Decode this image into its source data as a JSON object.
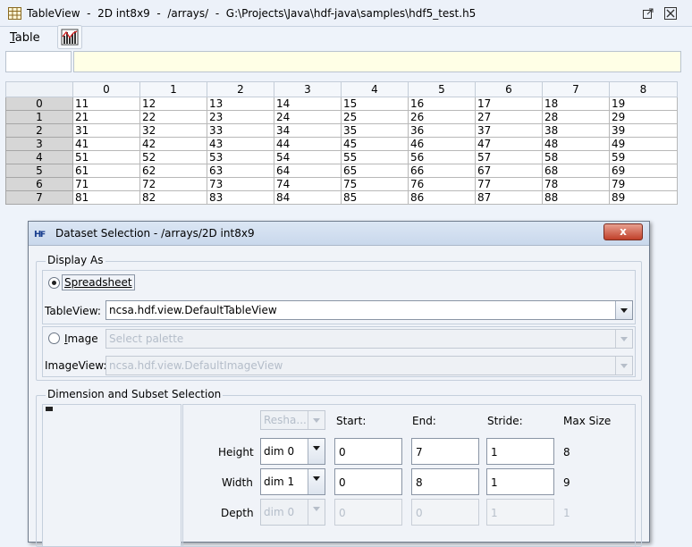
{
  "window": {
    "title": "TableView  -  2D int8x9  -  /arrays/  -  G:\\Projects\\Java\\hdf-java\\samples\\hdf5_test.h5"
  },
  "menu": {
    "table_mnemonic": "T",
    "table_rest": "able"
  },
  "table": {
    "columns": [
      "0",
      "1",
      "2",
      "3",
      "4",
      "5",
      "6",
      "7",
      "8"
    ],
    "rows": [
      {
        "label": "0",
        "cells": [
          "11",
          "12",
          "13",
          "14",
          "15",
          "16",
          "17",
          "18",
          "19"
        ]
      },
      {
        "label": "1",
        "cells": [
          "21",
          "22",
          "23",
          "24",
          "25",
          "26",
          "27",
          "28",
          "29"
        ]
      },
      {
        "label": "2",
        "cells": [
          "31",
          "32",
          "33",
          "34",
          "35",
          "36",
          "37",
          "38",
          "39"
        ]
      },
      {
        "label": "3",
        "cells": [
          "41",
          "42",
          "43",
          "44",
          "45",
          "46",
          "47",
          "48",
          "49"
        ]
      },
      {
        "label": "4",
        "cells": [
          "51",
          "52",
          "53",
          "54",
          "55",
          "56",
          "57",
          "58",
          "59"
        ]
      },
      {
        "label": "5",
        "cells": [
          "61",
          "62",
          "63",
          "64",
          "65",
          "66",
          "67",
          "68",
          "69"
        ]
      },
      {
        "label": "6",
        "cells": [
          "71",
          "72",
          "73",
          "74",
          "75",
          "76",
          "77",
          "78",
          "79"
        ]
      },
      {
        "label": "7",
        "cells": [
          "81",
          "82",
          "83",
          "84",
          "85",
          "86",
          "87",
          "88",
          "89"
        ]
      }
    ]
  },
  "dialog": {
    "title": "Dataset Selection - /arrays/2D int8x9",
    "close_label": "x",
    "display_as": {
      "label": "Display As",
      "spreadsheet_label": "Spreadsheet",
      "tableview_label": "TableView:",
      "tableview_value": "ncsa.hdf.view.DefaultTableView",
      "image_label": "Image",
      "palette_value": "Select palette",
      "imageview_label": "ImageView:",
      "imageview_value": "ncsa.hdf.view.DefaultImageView"
    },
    "dimension": {
      "label": "Dimension and Subset Selection",
      "reshape_value": "Resha...",
      "headers": {
        "start": "Start:",
        "end": "End:",
        "stride": "Stride:",
        "max": "Max Size"
      },
      "rows": [
        {
          "label": "Height",
          "dim": "dim 0",
          "start": "0",
          "end": "7",
          "stride": "1",
          "max": "8"
        },
        {
          "label": "Width",
          "dim": "dim 1",
          "start": "0",
          "end": "8",
          "stride": "1",
          "max": "9"
        },
        {
          "label": "Depth",
          "dim": "dim 0",
          "start": "0",
          "end": "0",
          "stride": "1",
          "max": "1"
        }
      ]
    }
  }
}
